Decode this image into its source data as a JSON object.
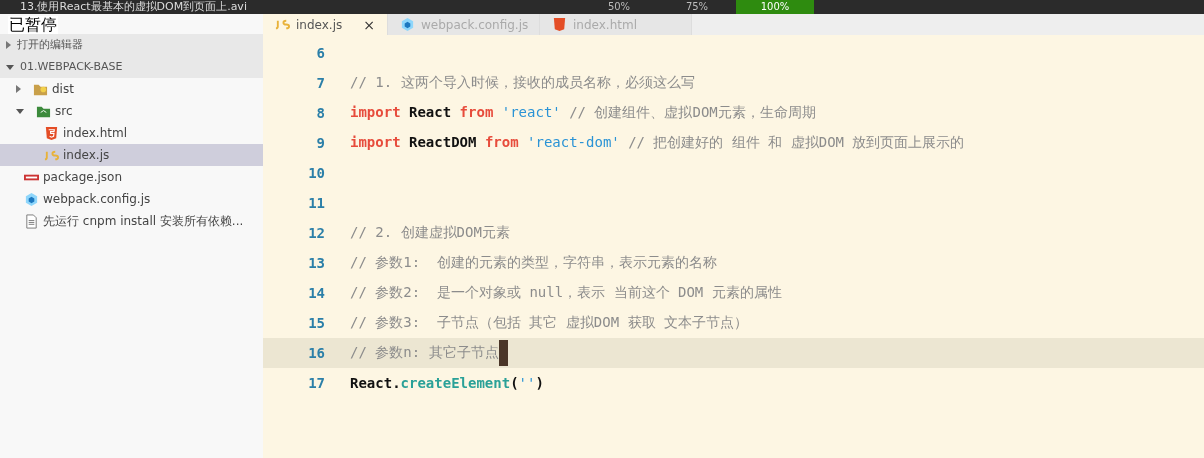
{
  "player_bar": {
    "title": "13.使用React最基本的虚拟DOM到页面上.avi",
    "zoom_options": [
      {
        "label": "50%",
        "selected": false
      },
      {
        "label": "75%",
        "selected": false
      },
      {
        "label": "100%",
        "selected": true
      }
    ]
  },
  "paused_label": "已暂停",
  "sidebar": {
    "sections": [
      {
        "label": "打开的编辑器",
        "expanded": false
      },
      {
        "label": "01.WEBPACK-BASE",
        "expanded": true
      }
    ],
    "items": [
      {
        "label": "dist",
        "kind": "folder",
        "expanded": false,
        "selected": false
      },
      {
        "label": "src",
        "kind": "src-folder",
        "expanded": true,
        "selected": false,
        "children": [
          {
            "label": "index.html",
            "kind": "html",
            "selected": false
          },
          {
            "label": "index.js",
            "kind": "js",
            "selected": true
          }
        ]
      },
      {
        "label": "package.json",
        "kind": "npm",
        "selected": false
      },
      {
        "label": "webpack.config.js",
        "kind": "webpack",
        "selected": false
      },
      {
        "label": "先运行 cnpm install 安装所有依赖...",
        "kind": "text",
        "selected": false
      }
    ]
  },
  "tabs": [
    {
      "label": "index.js",
      "kind": "js",
      "selected": true,
      "close": "×"
    },
    {
      "label": "webpack.config.js",
      "kind": "webpack",
      "selected": false
    },
    {
      "label": "index.html",
      "kind": "html",
      "selected": false
    }
  ],
  "code_lines": [
    {
      "number": "6",
      "current": false
    },
    {
      "number": "7",
      "current": false,
      "tokens": [
        {
          "kind": "comment",
          "text": "// 1. 这两个导入时候，接收的成员名称，必须这么写"
        }
      ]
    },
    {
      "number": "8",
      "current": false,
      "tokens": [
        {
          "kind": "keyword",
          "text": "import"
        },
        {
          "kind": "plain",
          "text": " React "
        },
        {
          "kind": "keyword",
          "text": "from"
        },
        {
          "kind": "string",
          "text": " 'react'"
        },
        {
          "kind": "comment",
          "text": " // 创建组件、虚拟DOM元素，生命周期"
        }
      ]
    },
    {
      "number": "9",
      "current": false,
      "tokens": [
        {
          "kind": "keyword",
          "text": "import"
        },
        {
          "kind": "plain",
          "text": " ReactDOM "
        },
        {
          "kind": "keyword",
          "text": "from"
        },
        {
          "kind": "string",
          "text": " 'react-dom'"
        },
        {
          "kind": "comment",
          "text": " // 把创建好的 组件 和 虚拟DOM 放到页面上展示的"
        }
      ]
    },
    {
      "number": "10",
      "current": false
    },
    {
      "number": "11",
      "current": false
    },
    {
      "number": "12",
      "current": false,
      "tokens": [
        {
          "kind": "comment",
          "text": "// 2. 创建虚拟DOM元素"
        }
      ]
    },
    {
      "number": "13",
      "current": false,
      "tokens": [
        {
          "kind": "comment",
          "text": "// 参数1:  创建的元素的类型，字符串，表示元素的名称"
        }
      ]
    },
    {
      "number": "14",
      "current": false,
      "tokens": [
        {
          "kind": "comment",
          "text": "// 参数2:  是一个对象或 null，表示 当前这个 DOM 元素的属性"
        }
      ]
    },
    {
      "number": "15",
      "current": false,
      "tokens": [
        {
          "kind": "comment",
          "text": "// 参数3:  子节点（包括 其它 虚拟DOM 获取 文本子节点）"
        }
      ]
    },
    {
      "number": "16",
      "current": true,
      "tokens": [
        {
          "kind": "comment",
          "text": "// 参数n: 其它子节点"
        }
      ]
    },
    {
      "number": "17",
      "current": false,
      "tokens": [
        {
          "kind": "plain",
          "text": "React."
        },
        {
          "kind": "func",
          "text": "createElement"
        },
        {
          "kind": "plain",
          "text": "("
        },
        {
          "kind": "string",
          "text": "''"
        },
        {
          "kind": "plain",
          "text": ")"
        }
      ]
    }
  ]
}
